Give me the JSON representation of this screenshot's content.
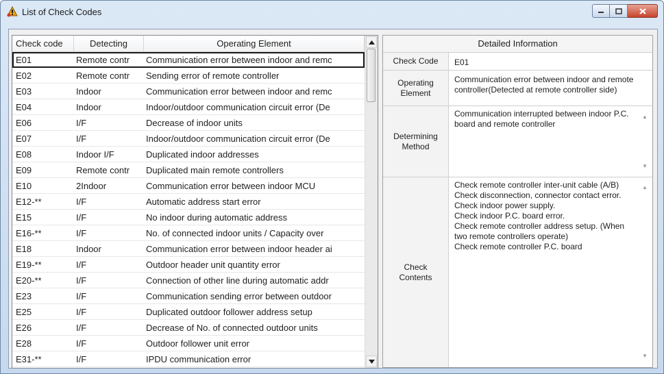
{
  "window": {
    "title": "List of Check Codes"
  },
  "icons": {
    "app": "warning-cone-icon",
    "minimize": "minimize-icon",
    "maximize": "maximize-icon",
    "close": "close-icon"
  },
  "list": {
    "headers": [
      "Check code",
      "Detecting",
      "Operating Element"
    ],
    "rows": [
      [
        "E01",
        "Remote contr",
        "Communication error between indoor and remc"
      ],
      [
        "E02",
        "Remote contr",
        "Sending error of remote controller"
      ],
      [
        "E03",
        "Indoor",
        "Communication error between indoor and remc"
      ],
      [
        "E04",
        "Indoor",
        "Indoor/outdoor communication circuit error (De"
      ],
      [
        "E06",
        "I/F",
        "Decrease of indoor units"
      ],
      [
        "E07",
        "I/F",
        "Indoor/outdoor communication circuit error (De"
      ],
      [
        "E08",
        "Indoor I/F",
        "Duplicated indoor addresses"
      ],
      [
        "E09",
        "Remote contr",
        "Duplicated main remote controllers"
      ],
      [
        "E10",
        "2Indoor",
        "Communication error between indoor MCU"
      ],
      [
        "E12-**",
        "I/F",
        "Automatic address start error"
      ],
      [
        "E15",
        "I/F",
        "No indoor during automatic address"
      ],
      [
        "E16-**",
        "I/F",
        "No. of connected indoor units / Capacity over"
      ],
      [
        "E18",
        "Indoor",
        "Communication error between indoor header ai"
      ],
      [
        "E19-**",
        "I/F",
        "Outdoor header unit quantity error"
      ],
      [
        "E20-**",
        "I/F",
        "Connection of other line during automatic addr"
      ],
      [
        "E23",
        "I/F",
        "Communication sending error between outdoor"
      ],
      [
        "E25",
        "I/F",
        "Duplicated outdoor follower address setup"
      ],
      [
        "E26",
        "I/F",
        "Decrease of No. of connected outdoor units"
      ],
      [
        "E28",
        "I/F",
        "Outdoor follower unit error"
      ],
      [
        "E31-**",
        "I/F",
        "IPDU communication error"
      ]
    ]
  },
  "detail": {
    "header": "Detailed Information",
    "check_code_label": "Check Code",
    "check_code_value": "E01",
    "operating_label": "Operating Element",
    "operating_value": "Communication error between indoor and remote controller(Detected at remote controller side)",
    "determining_label": "Determining Method",
    "determining_value": "Communication interrupted between indoor P.C. board and remote controller",
    "check_label": "Check Contents",
    "check_value": "Check remote controller inter-unit cable (A/B)\nCheck disconnection, connector contact error.\nCheck indoor power supply.\nCheck indoor P.C. board error.\nCheck remote controller address setup. (When two remote controllers operate)\nCheck remote controller P.C. board"
  }
}
